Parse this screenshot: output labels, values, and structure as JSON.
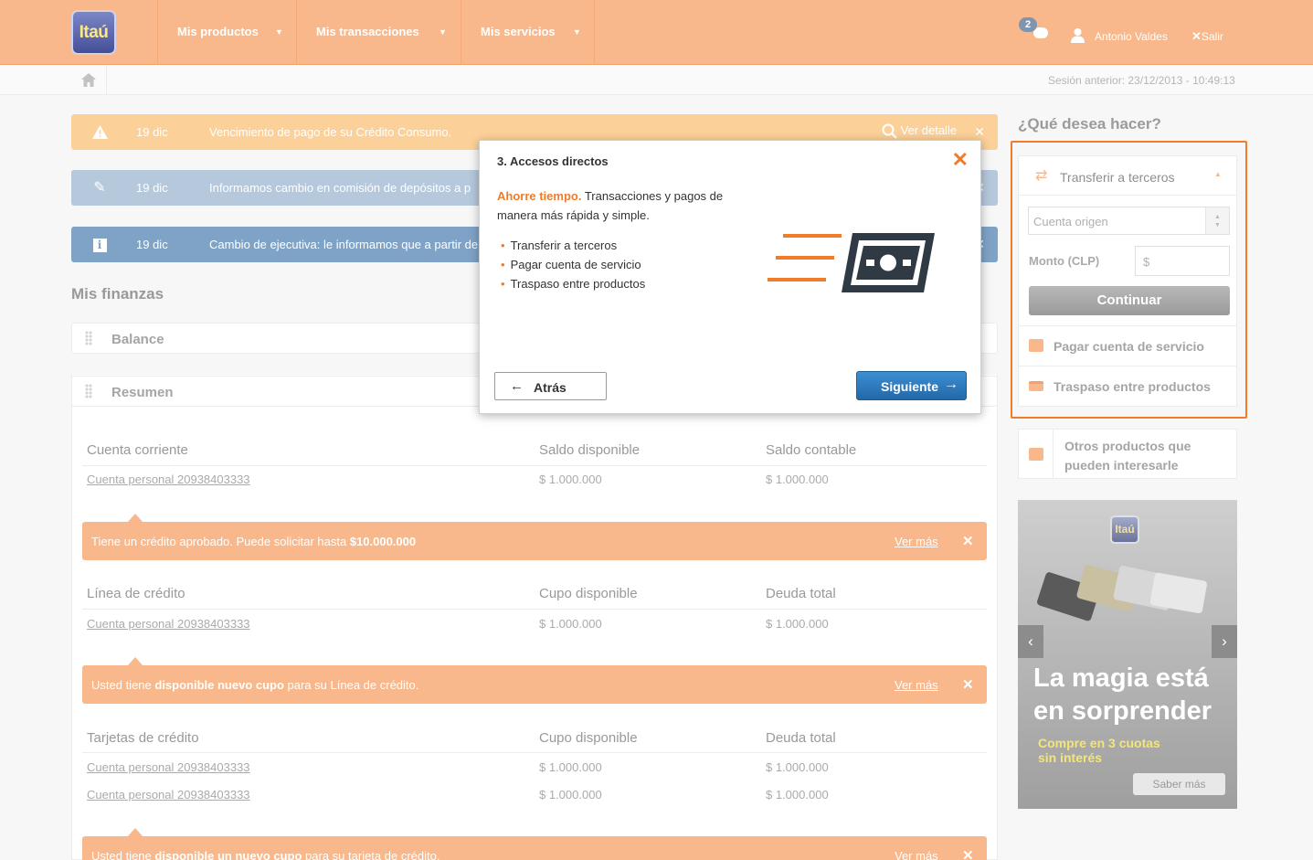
{
  "header": {
    "logo": "Itaú",
    "nav": [
      {
        "label": "Mis productos"
      },
      {
        "label": "Mis transacciones"
      },
      {
        "label": "Mis servicios"
      }
    ],
    "notifications_count": "2",
    "user_name": "Antonio Valdes",
    "logout": "Salir"
  },
  "subbar": {
    "session": "Sesión anterior: 23/12/2013 - 10:49:13"
  },
  "alerts": [
    {
      "date": "19 dic",
      "message": "Vencimiento de pago de su Crédito Consumo.",
      "action": "Ver detalle",
      "color": "#fcd199"
    },
    {
      "date": "19 dic",
      "message": "Informamos cambio en comisión de depósitos a p",
      "color": "#b5c8dc"
    },
    {
      "date": "19 dic",
      "message": "Cambio de ejecutiva: le informamos que a partir de",
      "color": "#7fa3c6"
    }
  ],
  "finanzas": {
    "title": "Mis finanzas",
    "balance": "Balance",
    "resumen": "Resumen",
    "cuenta": {
      "headers": [
        "Cuenta corriente",
        "Saldo disponible",
        "Saldo contable"
      ],
      "rows": [
        {
          "name": "Cuenta personal 20938403333",
          "a": "$ 1.000.000",
          "b": "$ 1.000.000"
        }
      ]
    },
    "banner1": {
      "text": "Tiene un crédito aprobado. Puede solicitar hasta ",
      "bold": "$10.000.000",
      "more": "Ver más"
    },
    "linea": {
      "headers": [
        "Línea de crédito",
        "Cupo disponible",
        "Deuda total"
      ],
      "rows": [
        {
          "name": "Cuenta personal 20938403333",
          "a": "$ 1.000.000",
          "b": "$ 1.000.000"
        }
      ]
    },
    "banner2": {
      "pre": "Usted tiene ",
      "bold": "disponible nuevo cupo",
      "post": " para su Línea de crédito.",
      "more": "Ver más"
    },
    "tarjetas": {
      "headers": [
        "Tarjetas de crédito",
        "Cupo disponible",
        "Deuda total"
      ],
      "rows": [
        {
          "name": "Cuenta personal 20938403333",
          "a": "$ 1.000.000",
          "b": "$ 1.000.000"
        },
        {
          "name": "Cuenta personal 20938403333",
          "a": "$ 1.000.000",
          "b": "$ 1.000.000"
        }
      ]
    },
    "banner3": {
      "pre": "Usted tiene ",
      "bold": "disponible un nuevo cupo",
      "post": " para su tarjeta de crédito.",
      "more": "Ver más"
    }
  },
  "sidebar": {
    "title": "¿Qué desea hacer?",
    "transfer": "Transferir a terceros",
    "origin_placeholder": "Cuenta origen",
    "amount_label": "Monto (CLP)",
    "amount_placeholder": "$",
    "continue": "Continuar",
    "pay": "Pagar cuenta de servicio",
    "traspaso": "Traspaso entre productos",
    "otros": "Otros productos que pueden interesarle"
  },
  "ad": {
    "logo": "Itaú",
    "headline1": "La magia está",
    "headline2": "en sorprender",
    "sub1": "Compre en 3 cuotas",
    "sub2": "sin interés",
    "cta": "Saber más"
  },
  "modal": {
    "title": "3. Accesos directos",
    "highlight": "Ahorre tiempo.",
    "desc": " Transacciones y pagos de manera más rápida y simple.",
    "items": [
      "Transferir a terceros",
      "Pagar cuenta de servicio",
      "Traspaso entre productos"
    ],
    "back": "Atrás",
    "next": "Siguiente"
  },
  "colors": {
    "accent": "#f07c2a",
    "header": "#f8b88b",
    "primary_button": "#2e78bd"
  }
}
